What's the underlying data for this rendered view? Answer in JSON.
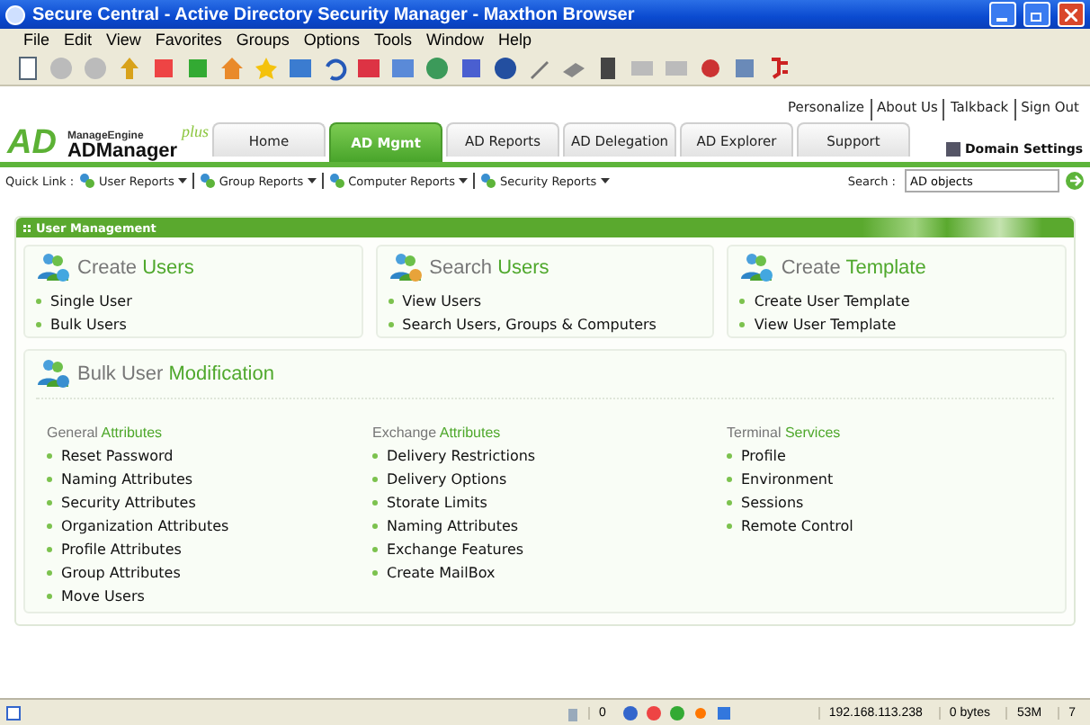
{
  "window": {
    "title": "Secure Central - Active Directory Security Manager - Maxthon Browser"
  },
  "menu": [
    "File",
    "Edit",
    "View",
    "Favorites",
    "Groups",
    "Options",
    "Tools",
    "Window",
    "Help"
  ],
  "top_links": [
    "Personalize",
    "About Us",
    "Talkback",
    "Sign Out"
  ],
  "logo": {
    "mark": "AD",
    "vendor": "ManageEngine",
    "product": "ADManager",
    "edition": "plus"
  },
  "tabs": [
    {
      "label": "Home",
      "selected": false
    },
    {
      "label": "AD Mgmt",
      "selected": true
    },
    {
      "label": "AD Reports",
      "selected": false
    },
    {
      "label": "AD Delegation",
      "selected": false
    },
    {
      "label": "AD Explorer",
      "selected": false
    },
    {
      "label": "Support",
      "selected": false
    }
  ],
  "domain_settings": "Domain Settings",
  "quick_links": {
    "label": "Quick Link :",
    "items": [
      "User Reports",
      "Group Reports",
      "Computer Reports",
      "Security Reports"
    ]
  },
  "search": {
    "label": "Search :",
    "value": "AD objects"
  },
  "section": {
    "title": "User Management",
    "cards": [
      {
        "title": {
          "plain": "Create",
          "accent": "Users"
        },
        "items": [
          "Single User",
          "Bulk Users"
        ]
      },
      {
        "title": {
          "plain": "Search",
          "accent": "Users"
        },
        "items": [
          "View Users",
          "Search Users, Groups & Computers"
        ]
      },
      {
        "title": {
          "plain": "Create",
          "accent": "Template"
        },
        "items": [
          "Create User Template",
          "View User Template"
        ]
      }
    ],
    "bulk": {
      "title": {
        "plain": "Bulk User",
        "accent": "Modification"
      },
      "groups": [
        {
          "heading": {
            "plain": "General",
            "accent": "Attributes"
          },
          "items": [
            "Reset Password",
            "Naming Attributes",
            "Security Attributes",
            "Organization Attributes",
            "Profile Attributes",
            "Group Attributes",
            "Move Users"
          ]
        },
        {
          "heading": {
            "plain": "Exchange",
            "accent": "Attributes"
          },
          "items": [
            "Delivery Restrictions",
            "Delivery Options",
            "Storate Limits",
            "Naming Attributes",
            "Exchange Features",
            "Create MailBox"
          ]
        },
        {
          "heading": {
            "plain": "Terminal",
            "accent": "Services"
          },
          "items": [
            "Profile",
            "Environment",
            "Sessions",
            "Remote Control"
          ]
        }
      ]
    }
  },
  "status_bar": {
    "count": "0",
    "ip": "192.168.113.238",
    "traffic": "0 bytes",
    "memory": "53M",
    "tabs": "7"
  }
}
